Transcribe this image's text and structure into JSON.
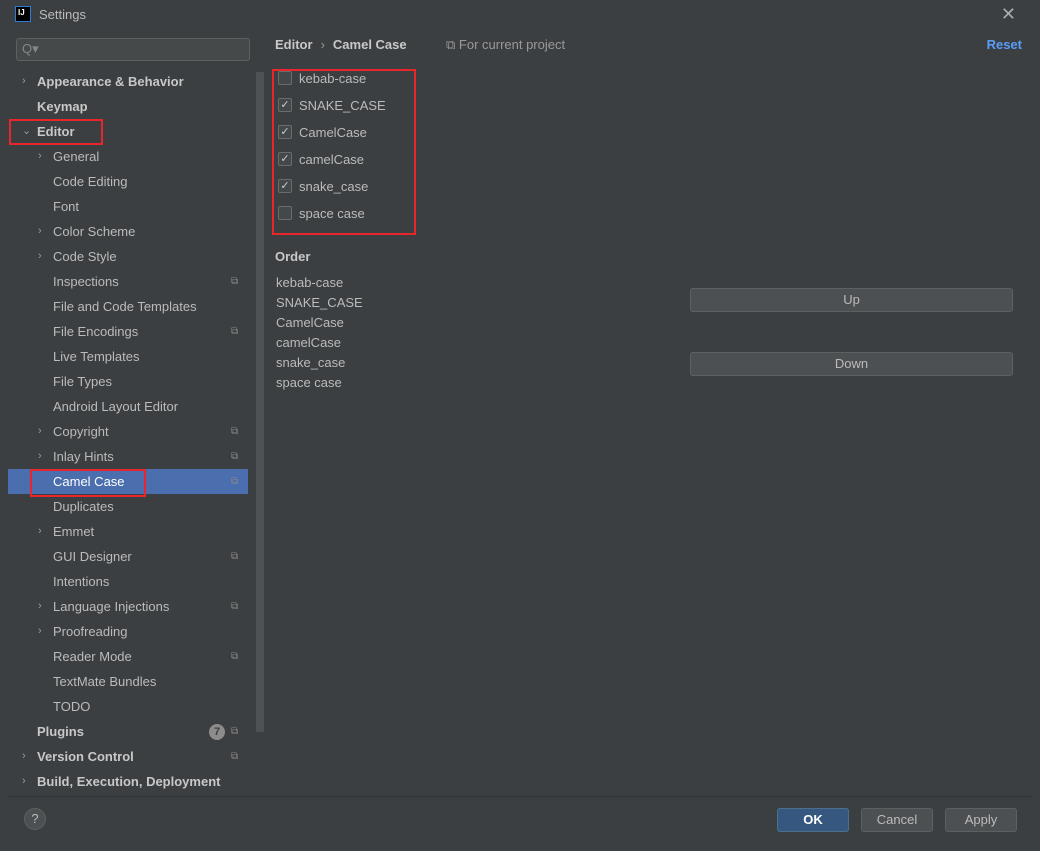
{
  "window": {
    "title": "Settings",
    "logo": "IJ"
  },
  "search": {
    "placeholder": "Q▾"
  },
  "tree": [
    {
      "label": "Appearance & Behavior",
      "level": 0,
      "arrow": "›"
    },
    {
      "label": "Keymap",
      "level": 0,
      "arrow": ""
    },
    {
      "label": "Editor",
      "level": 0,
      "arrow": "⌄"
    },
    {
      "label": "General",
      "level": 1,
      "arrow": "›"
    },
    {
      "label": "Code Editing",
      "level": 1,
      "arrow": ""
    },
    {
      "label": "Font",
      "level": 1,
      "arrow": ""
    },
    {
      "label": "Color Scheme",
      "level": 1,
      "arrow": "›"
    },
    {
      "label": "Code Style",
      "level": 1,
      "arrow": "›"
    },
    {
      "label": "Inspections",
      "level": 1,
      "arrow": "",
      "copy": true
    },
    {
      "label": "File and Code Templates",
      "level": 1,
      "arrow": ""
    },
    {
      "label": "File Encodings",
      "level": 1,
      "arrow": "",
      "copy": true
    },
    {
      "label": "Live Templates",
      "level": 1,
      "arrow": ""
    },
    {
      "label": "File Types",
      "level": 1,
      "arrow": ""
    },
    {
      "label": "Android Layout Editor",
      "level": 1,
      "arrow": ""
    },
    {
      "label": "Copyright",
      "level": 1,
      "arrow": "›",
      "copy": true
    },
    {
      "label": "Inlay Hints",
      "level": 1,
      "arrow": "›",
      "copy": true
    },
    {
      "label": "Camel Case",
      "level": 1,
      "arrow": "",
      "copy": true,
      "selected": true
    },
    {
      "label": "Duplicates",
      "level": 1,
      "arrow": ""
    },
    {
      "label": "Emmet",
      "level": 1,
      "arrow": "›"
    },
    {
      "label": "GUI Designer",
      "level": 1,
      "arrow": "",
      "copy": true
    },
    {
      "label": "Intentions",
      "level": 1,
      "arrow": ""
    },
    {
      "label": "Language Injections",
      "level": 1,
      "arrow": "›",
      "copy": true
    },
    {
      "label": "Proofreading",
      "level": 1,
      "arrow": "›"
    },
    {
      "label": "Reader Mode",
      "level": 1,
      "arrow": "",
      "copy": true
    },
    {
      "label": "TextMate Bundles",
      "level": 1,
      "arrow": ""
    },
    {
      "label": "TODO",
      "level": 1,
      "arrow": ""
    },
    {
      "label": "Plugins",
      "level": 0,
      "arrow": "",
      "copy": true,
      "badge": "7"
    },
    {
      "label": "Version Control",
      "level": 0,
      "arrow": "›",
      "copy": true
    },
    {
      "label": "Build, Execution, Deployment",
      "level": 0,
      "arrow": "›"
    }
  ],
  "main": {
    "breadcrumb": [
      "Editor",
      "Camel Case"
    ],
    "breadcrumb_sep": "›",
    "scope": "⧉ For current project",
    "reset": "Reset",
    "options": [
      {
        "label": "kebab-case",
        "checked": false
      },
      {
        "label": "SNAKE_CASE",
        "checked": true
      },
      {
        "label": "CamelCase",
        "checked": true
      },
      {
        "label": "camelCase",
        "checked": true
      },
      {
        "label": "snake_case",
        "checked": true
      },
      {
        "label": "space case",
        "checked": false
      }
    ],
    "order_title": "Order",
    "order": [
      "kebab-case",
      "SNAKE_CASE",
      "CamelCase",
      "camelCase",
      "snake_case",
      "space case"
    ],
    "up": "Up",
    "down": "Down"
  },
  "footer": {
    "help": "?",
    "ok": "OK",
    "cancel": "Cancel",
    "apply": "Apply"
  },
  "colors": {
    "selection": "#4b6eaf",
    "highlight": "#e8262c",
    "link": "#589df6",
    "ok": "#365880"
  }
}
